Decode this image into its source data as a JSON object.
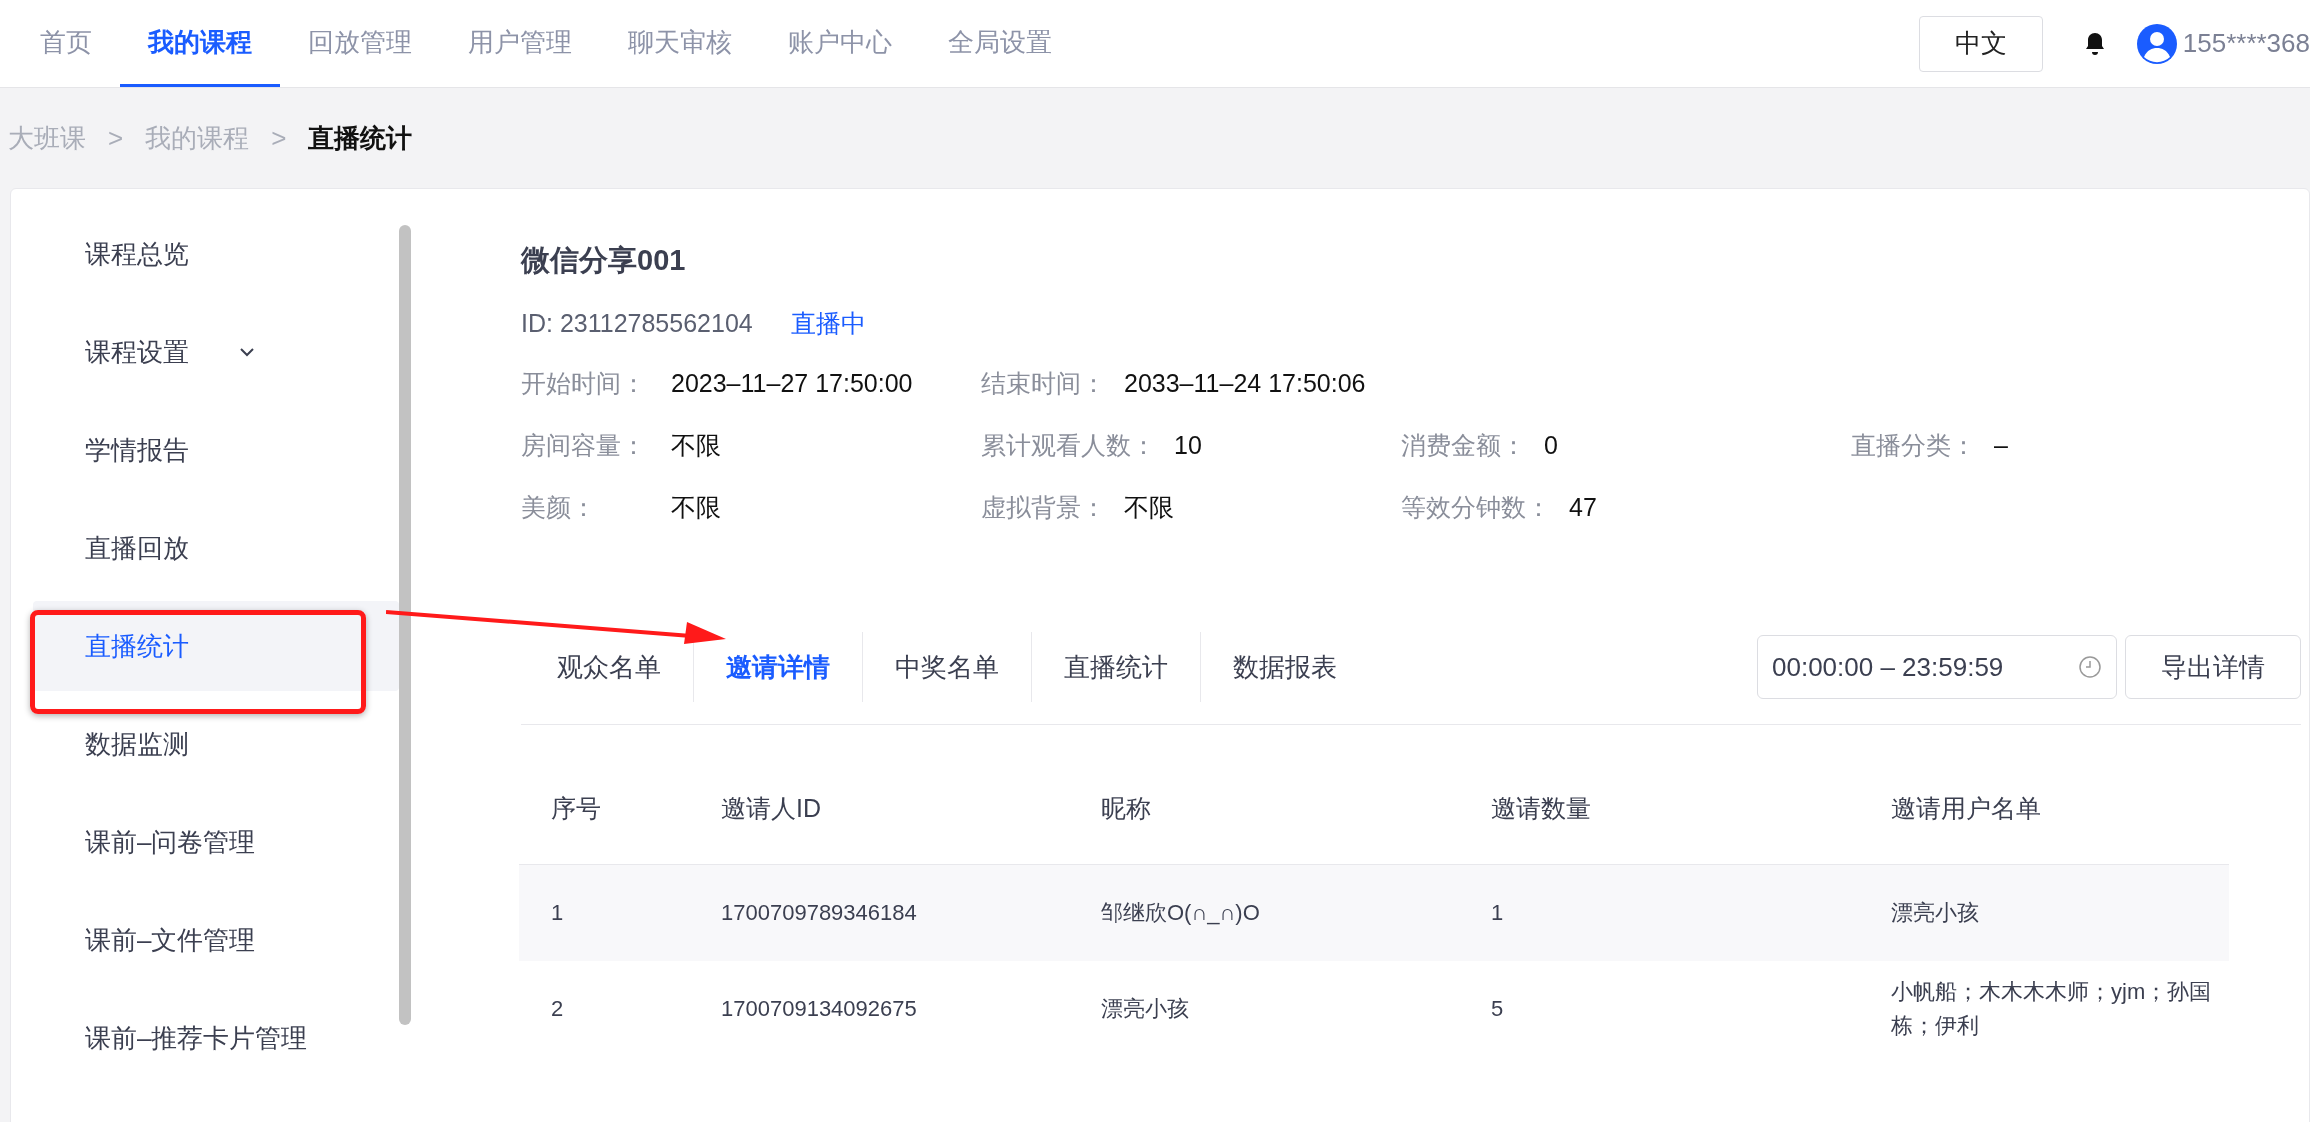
{
  "nav": {
    "items": [
      {
        "label": "首页",
        "selected": false
      },
      {
        "label": "我的课程",
        "selected": true
      },
      {
        "label": "回放管理",
        "selected": false
      },
      {
        "label": "用户管理",
        "selected": false
      },
      {
        "label": "聊天审核",
        "selected": false
      },
      {
        "label": "账户中心",
        "selected": false
      },
      {
        "label": "全局设置",
        "selected": false
      }
    ],
    "language": "中文",
    "username": "155****368"
  },
  "breadcrumb": [
    {
      "label": "大班课"
    },
    {
      "label": "我的课程"
    },
    {
      "label": "直播统计"
    }
  ],
  "breadcrumb_separator": ">",
  "sidebar": {
    "items": [
      {
        "label": "课程总览",
        "kind": "item",
        "selected": false
      },
      {
        "label": "课程设置",
        "kind": "submenu",
        "selected": false
      },
      {
        "label": "学情报告",
        "kind": "item",
        "selected": false
      },
      {
        "label": "直播回放",
        "kind": "item",
        "selected": false
      },
      {
        "label": "直播统计",
        "kind": "item",
        "selected": true
      },
      {
        "label": "数据监测",
        "kind": "item",
        "selected": false
      },
      {
        "label": "课前–问卷管理",
        "kind": "item",
        "selected": false
      },
      {
        "label": "课前–文件管理",
        "kind": "item",
        "selected": false
      },
      {
        "label": "课前–推荐卡片管理",
        "kind": "item",
        "selected": false
      }
    ]
  },
  "course": {
    "title": "微信分享001",
    "id": "ID: 23112785562104",
    "status": "直播中",
    "rows": [
      [
        {
          "label": "开始时间：",
          "value": "2023–11–27 17:50:00"
        },
        {
          "label": "结束时间：",
          "value": "2033–11–24 17:50:06"
        }
      ],
      [
        {
          "label": "房间容量：",
          "value": "不限"
        },
        {
          "label": "累计观看人数：",
          "value": "10"
        },
        {
          "label": "消费金额：",
          "value": "0"
        },
        {
          "label": "直播分类：",
          "value": "–"
        }
      ],
      [
        {
          "label": "美颜：",
          "value": "不限"
        },
        {
          "label": "虚拟背景：",
          "value": "不限"
        },
        {
          "label": "等效分钟数：",
          "value": "47"
        }
      ]
    ]
  },
  "tabs": [
    {
      "label": "观众名单",
      "selected": false
    },
    {
      "label": "邀请详情",
      "selected": true
    },
    {
      "label": "中奖名单",
      "selected": false
    },
    {
      "label": "直播统计",
      "selected": false
    },
    {
      "label": "数据报表",
      "selected": false
    }
  ],
  "time_range": "00:00:00 – 23:59:59",
  "export_button": "导出详情",
  "table": {
    "columns": [
      "序号",
      "邀请人ID",
      "昵称",
      "邀请数量",
      "邀请用户名单"
    ],
    "rows": [
      [
        "1",
        "1700709789346184",
        "邹继欣O(∩_∩)O",
        "1",
        "漂亮小孩"
      ],
      [
        "2",
        "1700709134092675",
        "漂亮小孩",
        "5",
        "小帆船；木木木木师；yjm；孙国栋；伊利"
      ]
    ]
  }
}
